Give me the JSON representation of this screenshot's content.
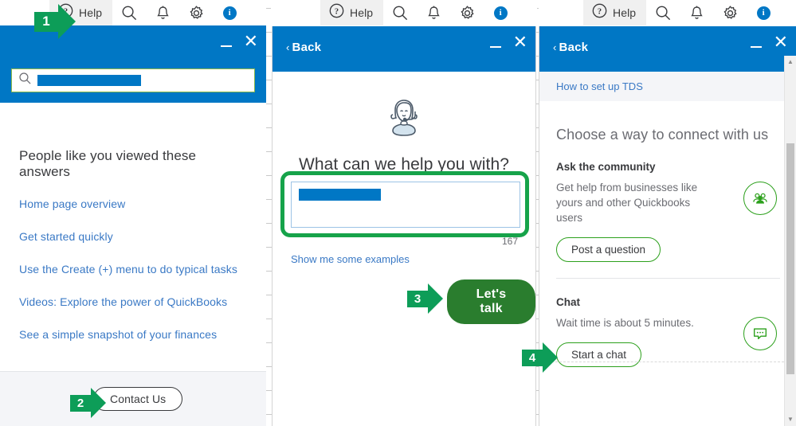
{
  "toolbar": {
    "help_label": "Help",
    "icons": [
      "help-circle-icon",
      "search-icon",
      "bell-icon",
      "gear-icon",
      "info-badge-icon"
    ],
    "info_badge": "i"
  },
  "panel1": {
    "search": {
      "value_redacted": true,
      "placeholder": ""
    },
    "title": "People like you viewed these answers",
    "links": [
      "Home page overview",
      "Get started quickly",
      "Use the Create (+) menu to do typical tasks",
      "Videos: Explore the power of QuickBooks",
      "See a simple snapshot of your finances"
    ],
    "contact_button": "Contact Us",
    "minimize": "minimize-icon",
    "close": "close-icon"
  },
  "panel2": {
    "back": "Back",
    "back_chevron": "‹",
    "avatar": "support-agent-avatar",
    "title": "What can we help you with?",
    "textarea_value_redacted": true,
    "char_count": "167",
    "examples_link": "Show me some examples",
    "primary_button": "Let's talk"
  },
  "panel3": {
    "back": "Back",
    "back_chevron": "‹",
    "breadcrumb_link": "How to set up TDS",
    "title": "Choose a way to connect with us",
    "sections": [
      {
        "heading": "Ask the community",
        "body": "Get help from businesses like yours and other Quickbooks users",
        "button": "Post a question",
        "icon": "people-group-icon"
      },
      {
        "heading": "Chat",
        "body": "Wait time is about 5 minutes.",
        "button": "Start a chat",
        "icon": "chat-bubble-icon"
      }
    ]
  },
  "steps": [
    {
      "number": "1",
      "target": "help-menu-button"
    },
    {
      "number": "2",
      "target": "contact-us-button"
    },
    {
      "number": "3",
      "target": "lets-talk-button"
    },
    {
      "number": "4",
      "target": "start-a-chat-button"
    }
  ],
  "colors": {
    "brand_blue": "#0077c5",
    "brand_green": "#2ca01c",
    "marker_green": "#0d9d58",
    "lets_talk_green": "#2a7d2e",
    "link_blue": "#3a79c5"
  }
}
